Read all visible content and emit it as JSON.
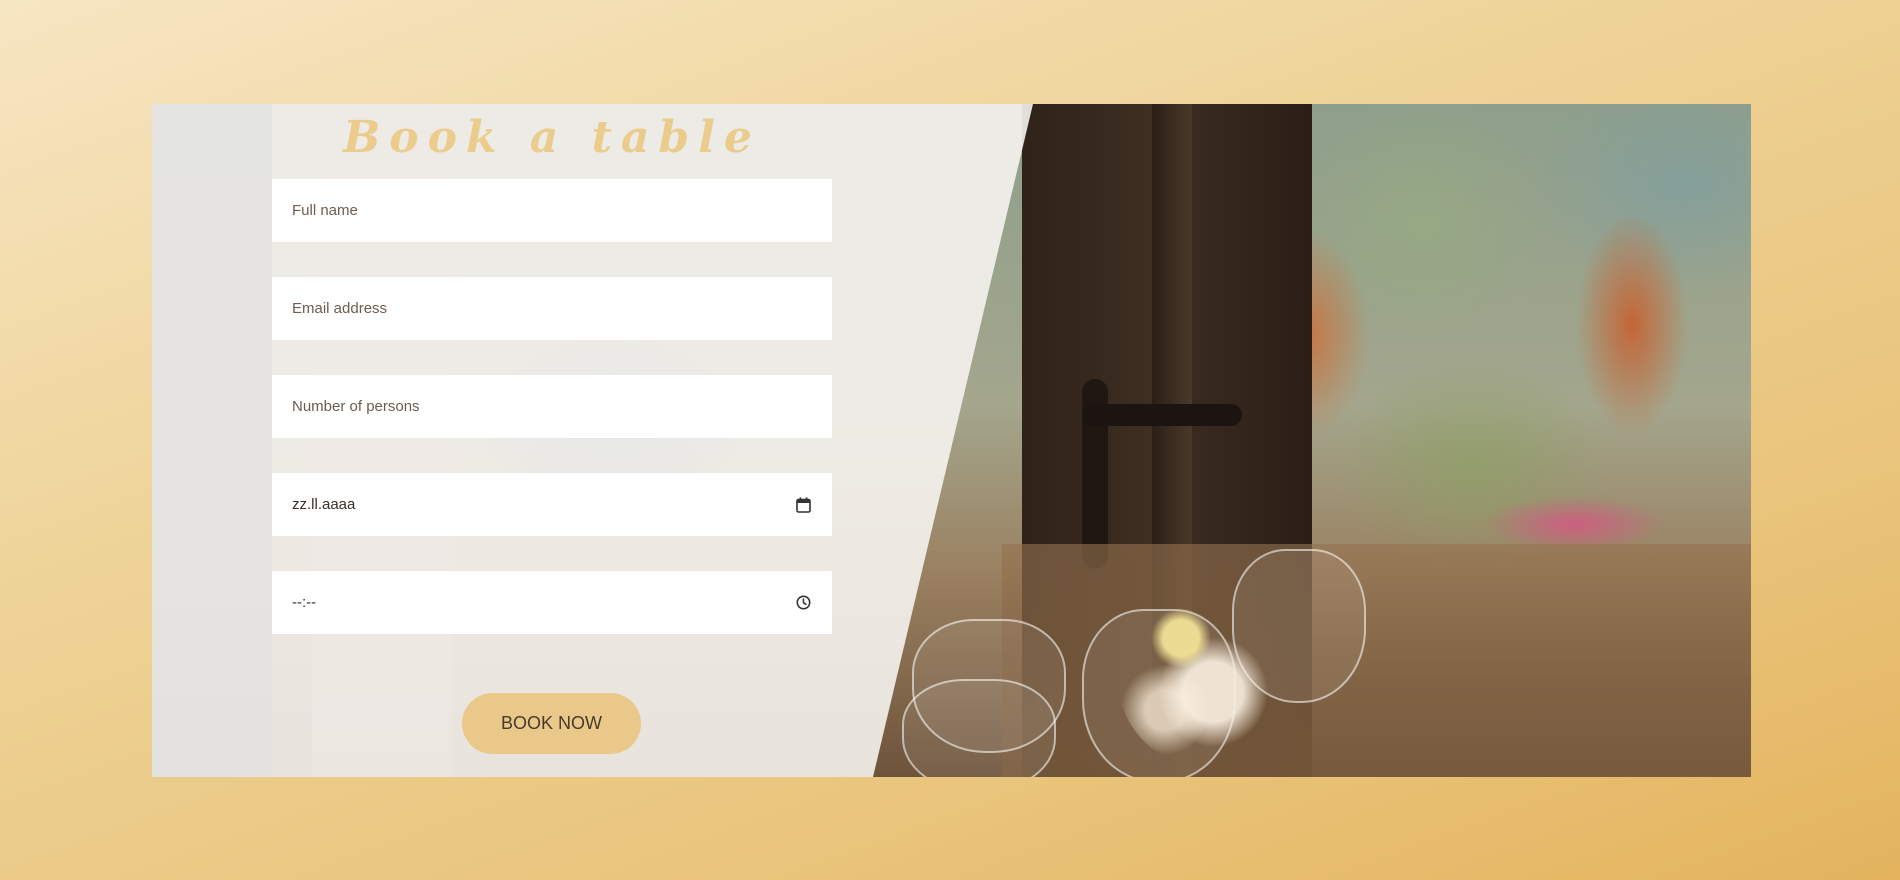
{
  "form": {
    "title": "Book a table",
    "fields": [
      {
        "placeholder": "Full name",
        "icon": ""
      },
      {
        "placeholder": "Email address",
        "icon": ""
      },
      {
        "placeholder": "Number of persons",
        "icon": ""
      },
      {
        "value": "zz.ll.aaaa",
        "icon": "calendar-icon"
      },
      {
        "value": "--:--",
        "icon": "clock-icon"
      }
    ],
    "submit_label": "BOOK NOW"
  },
  "colors": {
    "accent": "#e9c88a",
    "title": "#eccc8c",
    "background": "#eed296"
  }
}
